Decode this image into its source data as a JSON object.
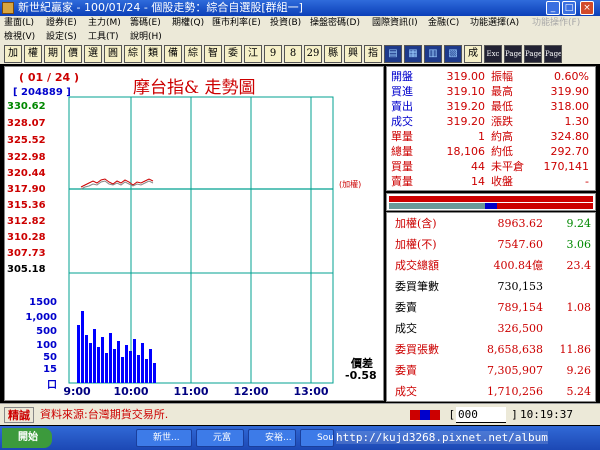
{
  "window": {
    "title": "新世紀贏家 - 100/01/24 - 個股走勢：綜合自選股[群組一]",
    "min": "_",
    "max": "□",
    "close": "×"
  },
  "menu1": [
    "畫面(L)",
    "證券(E)",
    "主力(M)",
    "籌碼(E)",
    "期權(Q)",
    "匯市利率(E)",
    "投資(B)",
    "操盤密碼(D)",
    "國際資訊(I)",
    "金融(C)",
    "功能選擇(A)",
    "功能操作(F)"
  ],
  "menu2": [
    "檢視(V)",
    "設定(S)",
    "工具(T)",
    "說明(H)"
  ],
  "toolbar": [
    "加",
    "權",
    "期",
    "價",
    "選",
    "圓",
    "綜",
    "類",
    "備",
    "綜",
    "智",
    "委",
    "江",
    "9",
    "8",
    "29",
    "縣",
    "興",
    "指",
    "",
    "",
    "",
    "",
    "成",
    "Exc",
    "Page",
    "Page",
    "Page"
  ],
  "chart": {
    "date_label": "( 01 / 24 )",
    "volume_label": "[ 204889 ]",
    "title": "摩台指&  走勢圖",
    "ref_label": "(加權)",
    "spread_title": "價差",
    "spread_value": "-0.58",
    "price_ticks": [
      {
        "label": "330.62",
        "color": "#008800"
      },
      {
        "label": "328.07",
        "color": "#cc0000"
      },
      {
        "label": "325.52",
        "color": "#cc0000"
      },
      {
        "label": "322.98",
        "color": "#cc0000"
      },
      {
        "label": "320.44",
        "color": "#cc0000"
      },
      {
        "label": "317.90",
        "color": "#cc0000"
      },
      {
        "label": "315.36",
        "color": "#cc0000"
      },
      {
        "label": "312.82",
        "color": "#cc0000"
      },
      {
        "label": "310.28",
        "color": "#cc0000"
      },
      {
        "label": "307.73",
        "color": "#cc0000"
      },
      {
        "label": "305.18",
        "color": "#000000"
      }
    ],
    "vol_ticks": [
      "1500",
      "1,000",
      "500",
      "100",
      "50",
      "15",
      "口"
    ],
    "time_ticks": [
      "9:00",
      "10:00",
      "11:00",
      "12:00",
      "13:00"
    ]
  },
  "info": {
    "rows": [
      {
        "l1": "開盤",
        "v1": "319.00",
        "l2": "振幅",
        "v2": "0.60%"
      },
      {
        "l1": "買進",
        "v1": "319.10",
        "l2": "最高",
        "v2": "319.90"
      },
      {
        "l1": "賣出",
        "v1": "319.20",
        "l2": "最低",
        "v2": "318.00"
      },
      {
        "l1": "成交",
        "v1": "319.20",
        "l2": "漲跌",
        "v2": "1.30"
      },
      {
        "l1": "單量",
        "v1": "1",
        "l2": "約高",
        "v2": "324.80"
      },
      {
        "l1": "總量",
        "v1": "18,106",
        "l2": "約低",
        "v2": "292.70"
      },
      {
        "l1": "買量",
        "v1": "44",
        "l2": "未平倉",
        "v2": "170,141"
      },
      {
        "l1": "賣量",
        "v1": "14",
        "l2": "收盤",
        "v2": "-"
      }
    ]
  },
  "index": {
    "rows": [
      {
        "label": "加權(含)",
        "value": "8963.62",
        "extra": "9.24"
      },
      {
        "label": "加權(不)",
        "value": "7547.60",
        "extra": "3.06"
      },
      {
        "label": "成交總額",
        "value": "400.84億",
        "extra": "23.4"
      },
      {
        "label": "委買筆數",
        "value": "730,153",
        "extra": ""
      },
      {
        "label": "委賣",
        "value": "789,154",
        "extra": "1.08"
      },
      {
        "label": "成交",
        "value": "326,500",
        "extra": ""
      },
      {
        "label": "委買張數",
        "value": "8,658,638",
        "extra": "11.86"
      },
      {
        "label": "委賣",
        "value": "7,305,907",
        "extra": "9.26"
      },
      {
        "label": "成交",
        "value": "1,710,256",
        "extra": "5.24"
      }
    ]
  },
  "status": {
    "badge": "精誠",
    "source": "資料來源:台灣期貨交易所.",
    "input": "000",
    "time": "10:19:37"
  },
  "taskbar": {
    "start": "開始",
    "tasks": [
      "新世...",
      "元富",
      "安裕...",
      "Sound..."
    ],
    "watermark": "http://kujd3268.pixnet.net/album"
  }
}
